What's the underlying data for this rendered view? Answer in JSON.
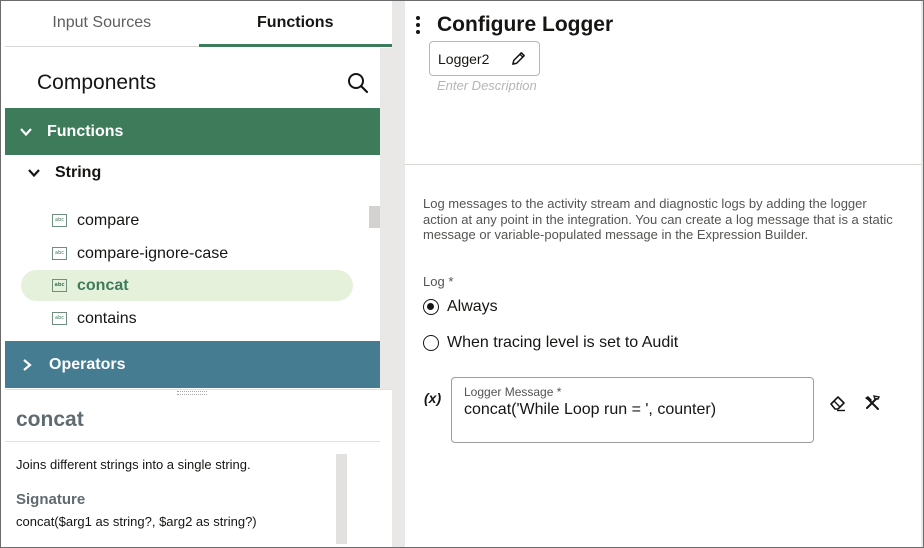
{
  "tabs": [
    {
      "label": "Input Sources"
    },
    {
      "label": "Functions"
    }
  ],
  "components": {
    "title": "Components",
    "functions_group": "Functions",
    "string_group": "String",
    "items": [
      {
        "label": "compare",
        "icon": "abc"
      },
      {
        "label": "compare-ignore-case",
        "icon": "abc"
      },
      {
        "label": "concat",
        "icon": "abc"
      },
      {
        "label": "contains",
        "icon": "abc"
      }
    ],
    "operators_group": "Operators"
  },
  "detail": {
    "title": "concat",
    "description": "Joins different strings into a single string.",
    "signature_label": "Signature",
    "signature": "concat($arg1 as string?, $arg2 as string?)"
  },
  "configure": {
    "title": "Configure Logger",
    "name": "Logger2",
    "description_placeholder": "Enter Description",
    "info": "Log messages to the activity stream and diagnostic logs by adding the logger action at any point in the integration. You can create a log message that is a static message or variable-populated message in the Expression Builder.",
    "log_label": "Log",
    "log_required": "*",
    "options": [
      {
        "label": "Always",
        "selected": true
      },
      {
        "label": "When tracing level is set to Audit",
        "selected": false
      }
    ],
    "fx_label": "(x)",
    "message_label": "Logger Message *",
    "message_value": "concat('While Loop run = ', counter)"
  },
  "colors": {
    "functions_header": "#3e7b5b",
    "operators_header": "#467c92",
    "selected_bg": "#e6f1dc"
  }
}
